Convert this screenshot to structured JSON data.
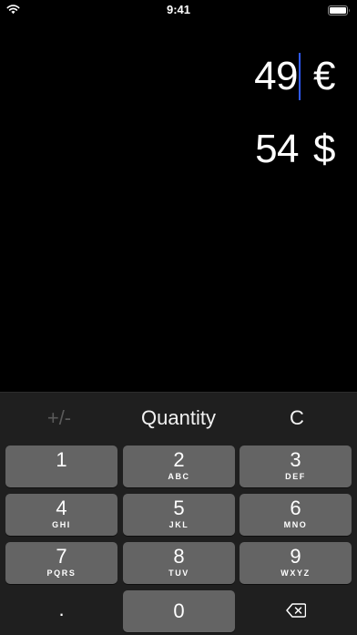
{
  "status_bar": {
    "time": "9:41"
  },
  "conversion": {
    "primary": {
      "amount": "49",
      "currency": "€"
    },
    "secondary": {
      "amount": "54",
      "currency": "$"
    }
  },
  "toolbar": {
    "sign_label": "+/-",
    "unit_label": "Quantity",
    "clear_label": "C"
  },
  "keypad": {
    "keys": [
      {
        "digit": "1",
        "letters": ""
      },
      {
        "digit": "2",
        "letters": "ABC"
      },
      {
        "digit": "3",
        "letters": "DEF"
      },
      {
        "digit": "4",
        "letters": "GHI"
      },
      {
        "digit": "5",
        "letters": "JKL"
      },
      {
        "digit": "6",
        "letters": "MNO"
      },
      {
        "digit": "7",
        "letters": "PQRS"
      },
      {
        "digit": "8",
        "letters": "TUV"
      },
      {
        "digit": "9",
        "letters": "WXYZ"
      }
    ],
    "decimal": ".",
    "zero": "0"
  },
  "colors": {
    "background": "#000000",
    "keyboard_background": "#1f1f1f",
    "key_background": "#646464",
    "cursor": "#2f5bff",
    "disabled_text": "#5a5a5a"
  },
  "icons": {
    "wifi": "wifi-icon",
    "battery": "battery-icon",
    "backspace": "backspace-icon"
  }
}
